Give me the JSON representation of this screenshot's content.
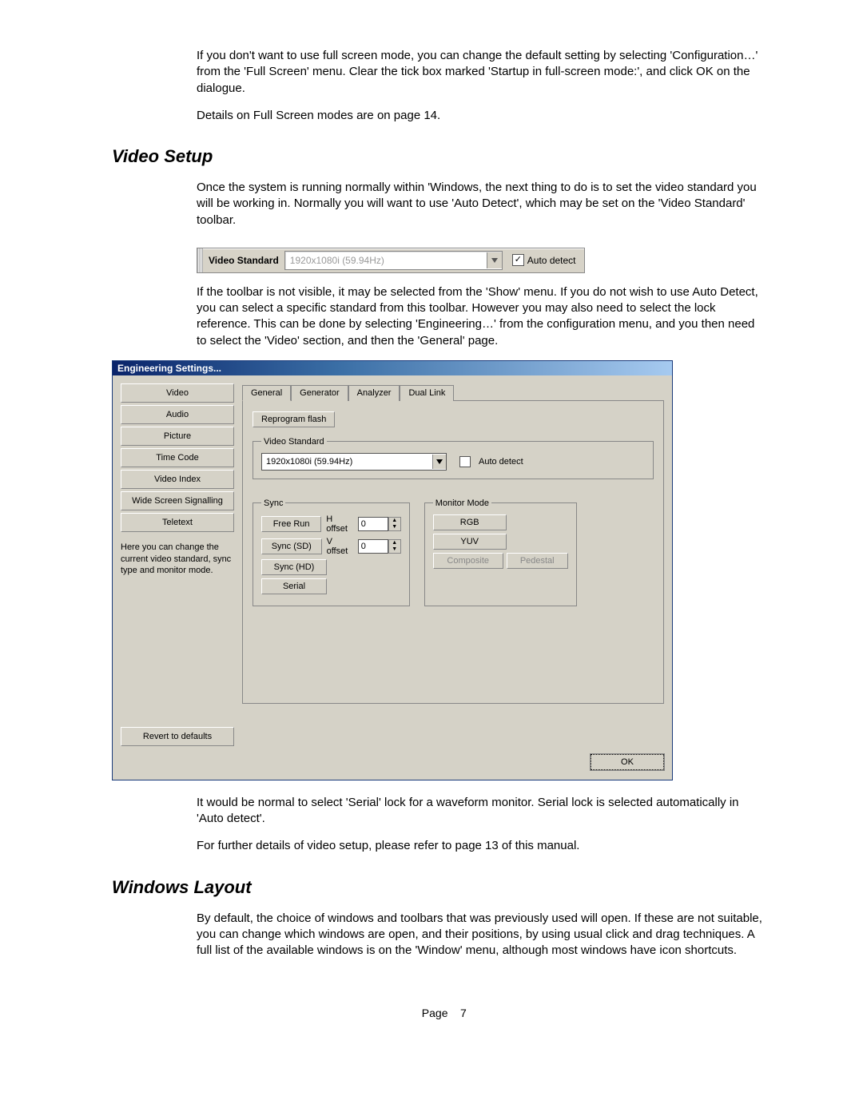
{
  "paragraphs": {
    "intro1": "If you don't want to use full screen mode, you can change the default setting by selecting 'Configuration…' from the 'Full Screen' menu.  Clear the tick box marked 'Startup in full-screen mode:', and click OK on the dialogue.",
    "intro2": "Details on Full Screen modes are on page 14.",
    "vs1": "Once the system is running normally within 'Windows, the next thing to do is to set the video standard you will be working in.   Normally you will want to use 'Auto Detect', which may be set on the 'Video Standard' toolbar.",
    "vs2": "If the toolbar is not visible, it may be selected from the 'Show' menu.  If you do not wish to use Auto Detect, you can select a specific standard from this toolbar.  However you may also need to select the lock reference.  This can be done by selecting 'Engineering…' from the configuration menu, and you then need to select the 'Video' section, and then the 'General' page.",
    "vs3": "It would be normal to select 'Serial' lock for a waveform monitor.  Serial lock is selected automatically in 'Auto detect'.",
    "vs4": "For further details of video setup, please refer to page 13 of this manual.",
    "wl1": "By default, the choice of windows and toolbars that was previously used will open.  If these are not suitable, you can change which windows are open, and their positions, by using usual click and drag techniques.  A full list of the available windows is on the 'Window' menu, although most windows have icon shortcuts."
  },
  "headings": {
    "video_setup": "Video Setup",
    "windows_layout": "Windows Layout"
  },
  "toolbar": {
    "label": "Video Standard",
    "value": "1920x1080i (59.94Hz)",
    "auto_detect_label": "Auto detect",
    "auto_detect_checked": true
  },
  "dialog": {
    "title": "Engineering Settings...",
    "sidebar_items": [
      "Video",
      "Audio",
      "Picture",
      "Time Code",
      "Video Index",
      "Wide Screen Signalling",
      "Teletext"
    ],
    "sidebar_hint": "Here you can change the current video standard, sync type and monitor mode.",
    "revert_label": "Revert to defaults",
    "tabs": [
      "General",
      "Generator",
      "Analyzer",
      "Dual Link"
    ],
    "active_tab": "General",
    "reprogram_label": "Reprogram flash",
    "video_standard_legend": "Video Standard",
    "video_standard_value": "1920x1080i (59.94Hz)",
    "video_standard_auto_label": "Auto detect",
    "sync_legend": "Sync",
    "sync_buttons": [
      "Free Run",
      "Sync (SD)",
      "Sync (HD)",
      "Serial"
    ],
    "h_offset_label": "H offset",
    "v_offset_label": "V offset",
    "h_offset_value": "0",
    "v_offset_value": "0",
    "monitor_legend": "Monitor Mode",
    "monitor_buttons": [
      "RGB",
      "YUV"
    ],
    "monitor_composite": "Composite",
    "monitor_pedestal": "Pedestal",
    "ok_label": "OK"
  },
  "footer": {
    "page_label": "Page",
    "page_number": "7"
  }
}
